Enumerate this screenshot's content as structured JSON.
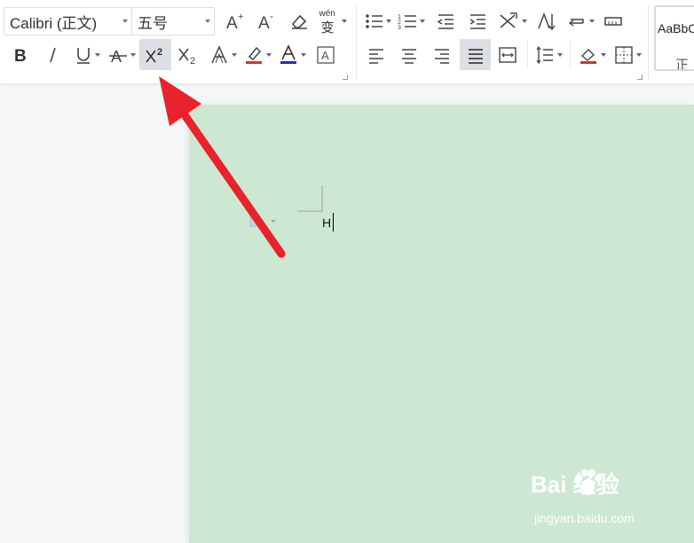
{
  "ribbon": {
    "font_name": "Calibri (正文)",
    "font_size": "五号",
    "phonetic_label": "wén",
    "phonetic_char": "变",
    "style_preview": "AaBbC",
    "style_name": "正"
  },
  "document": {
    "typed_text": "H"
  },
  "watermark": {
    "brand": "Bai  经验",
    "url": "jingyan.baidu.com"
  },
  "colors": {
    "page_bg": "#cde8d2",
    "arrow": "#e8232c",
    "highlight": "#d9312b",
    "font_color": "#1f2ad6"
  },
  "icons": [
    "bold",
    "italic",
    "underline",
    "strikethrough",
    "superscript",
    "subscript",
    "text-effect",
    "highlighter",
    "font-color",
    "char-border",
    "increase-font",
    "decrease-font",
    "clear-format",
    "bullets",
    "numbering",
    "decrease-indent",
    "increase-indent",
    "chinese-layout",
    "sort",
    "show-marks",
    "align-left",
    "align-center",
    "align-right",
    "justify",
    "distributed",
    "line-spacing",
    "shading",
    "borders"
  ]
}
